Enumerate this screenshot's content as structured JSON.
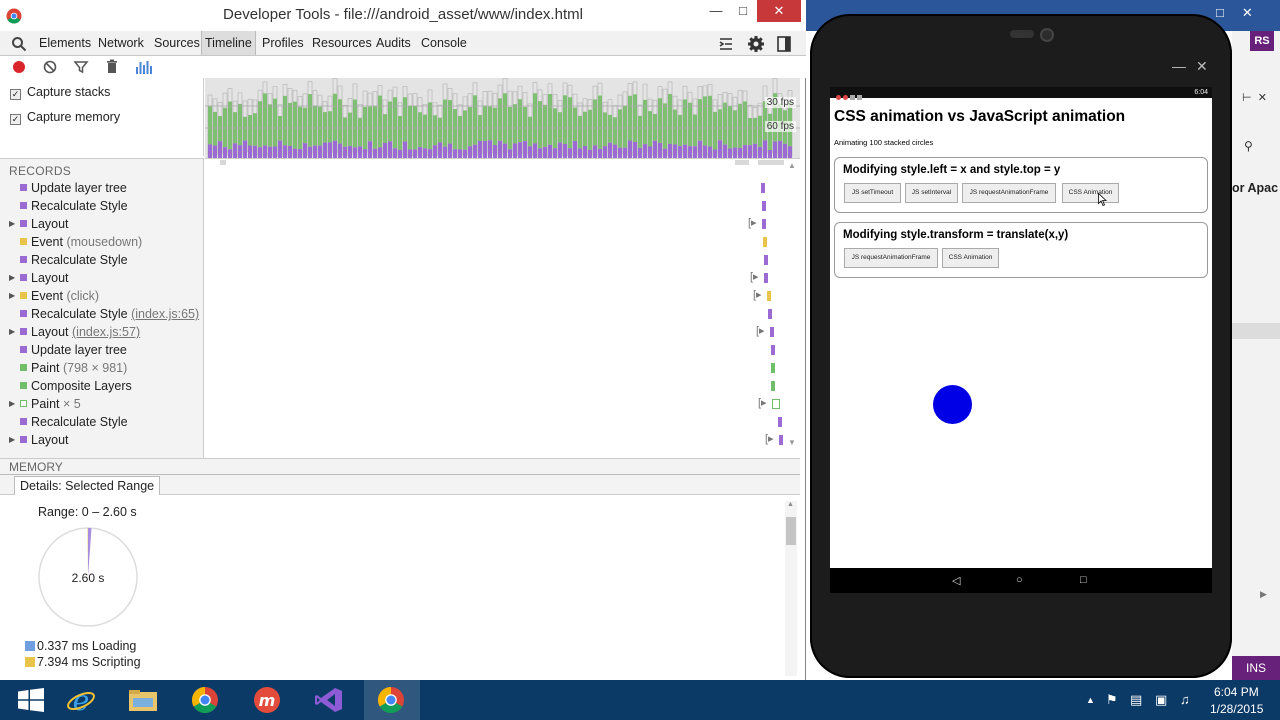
{
  "devtools": {
    "title": "Developer Tools - file:///android_asset/www/index.html",
    "tabs": [
      "Elements",
      "Network",
      "Sources",
      "Timeline",
      "Profiles",
      "Resources",
      "Audits",
      "Console"
    ],
    "active_tab": "Timeline",
    "capture_stacks_label": "Capture stacks",
    "capture_memory_label": "Capture memory",
    "fps_30": "30 fps",
    "fps_60": "60 fps",
    "records_title": "RECORDS",
    "records": [
      {
        "label": "Update layer tree",
        "detail": "",
        "link": "",
        "color": "#9b6bd3",
        "expandable": false
      },
      {
        "label": "Recalculate Style",
        "detail": "",
        "link": "",
        "color": "#9b6bd3",
        "expandable": false
      },
      {
        "label": "Layout",
        "detail": "",
        "link": "",
        "color": "#9b6bd3",
        "expandable": true
      },
      {
        "label": "Event",
        "detail": "(mousedown)",
        "link": "",
        "color": "#e8c54a",
        "expandable": false
      },
      {
        "label": "Recalculate Style",
        "detail": "",
        "link": "",
        "color": "#9b6bd3",
        "expandable": false
      },
      {
        "label": "Layout",
        "detail": "",
        "link": "",
        "color": "#9b6bd3",
        "expandable": true
      },
      {
        "label": "Event",
        "detail": "(click)",
        "link": "",
        "color": "#e8c54a",
        "expandable": true
      },
      {
        "label": "Recalculate Style",
        "detail": "",
        "link": "(index.js:65)",
        "color": "#9b6bd3",
        "expandable": false
      },
      {
        "label": "Layout",
        "detail": "",
        "link": "(index.js:57)",
        "color": "#9b6bd3",
        "expandable": true
      },
      {
        "label": "Update layer tree",
        "detail": "",
        "link": "",
        "color": "#9b6bd3",
        "expandable": false
      },
      {
        "label": "Paint",
        "detail": "(798 × 981)",
        "link": "",
        "color": "#6fbf6a",
        "expandable": false
      },
      {
        "label": "Composite Layers",
        "detail": "",
        "link": "",
        "color": "#6fbf6a",
        "expandable": false
      },
      {
        "label": "Paint",
        "detail": "× 5",
        "link": "",
        "color": "#ffffff",
        "expandable": true
      },
      {
        "label": "Recalculate Style",
        "detail": "",
        "link": "",
        "color": "#9b6bd3",
        "expandable": false
      },
      {
        "label": "Layout",
        "detail": "",
        "link": "",
        "color": "#9b6bd3",
        "expandable": true
      }
    ],
    "memory_title": "MEMORY",
    "details_tab": "Details: Selected Range",
    "range_label": "Range: 0 – 2.60 s",
    "pie_center": "2.60 s",
    "legend": [
      {
        "label": "0.337 ms Loading",
        "color": "#6f9fe0"
      },
      {
        "label": "7.394 ms Scripting",
        "color": "#e8c54a"
      }
    ]
  },
  "app_page": {
    "heading": "CSS animation vs JavaScript animation",
    "subtitle": "Animating 100 stacked circles",
    "status_time": "6:04",
    "box1_title": "Modifying style.left = x and style.top = y",
    "box1_buttons": [
      "JS setTimeout",
      "JS setInterval",
      "JS requestAnimationFrame",
      "CSS Animation"
    ],
    "box2_title": "Modifying style.transform = translate(x,y)",
    "box2_buttons": [
      "JS requestAnimationFrame",
      "CSS Animation"
    ]
  },
  "background_window": {
    "avatar": "RS",
    "truncated_text": "or Apac",
    "ins": "INS"
  },
  "taskbar": {
    "time": "6:04 PM",
    "date": "1/28/2015"
  }
}
